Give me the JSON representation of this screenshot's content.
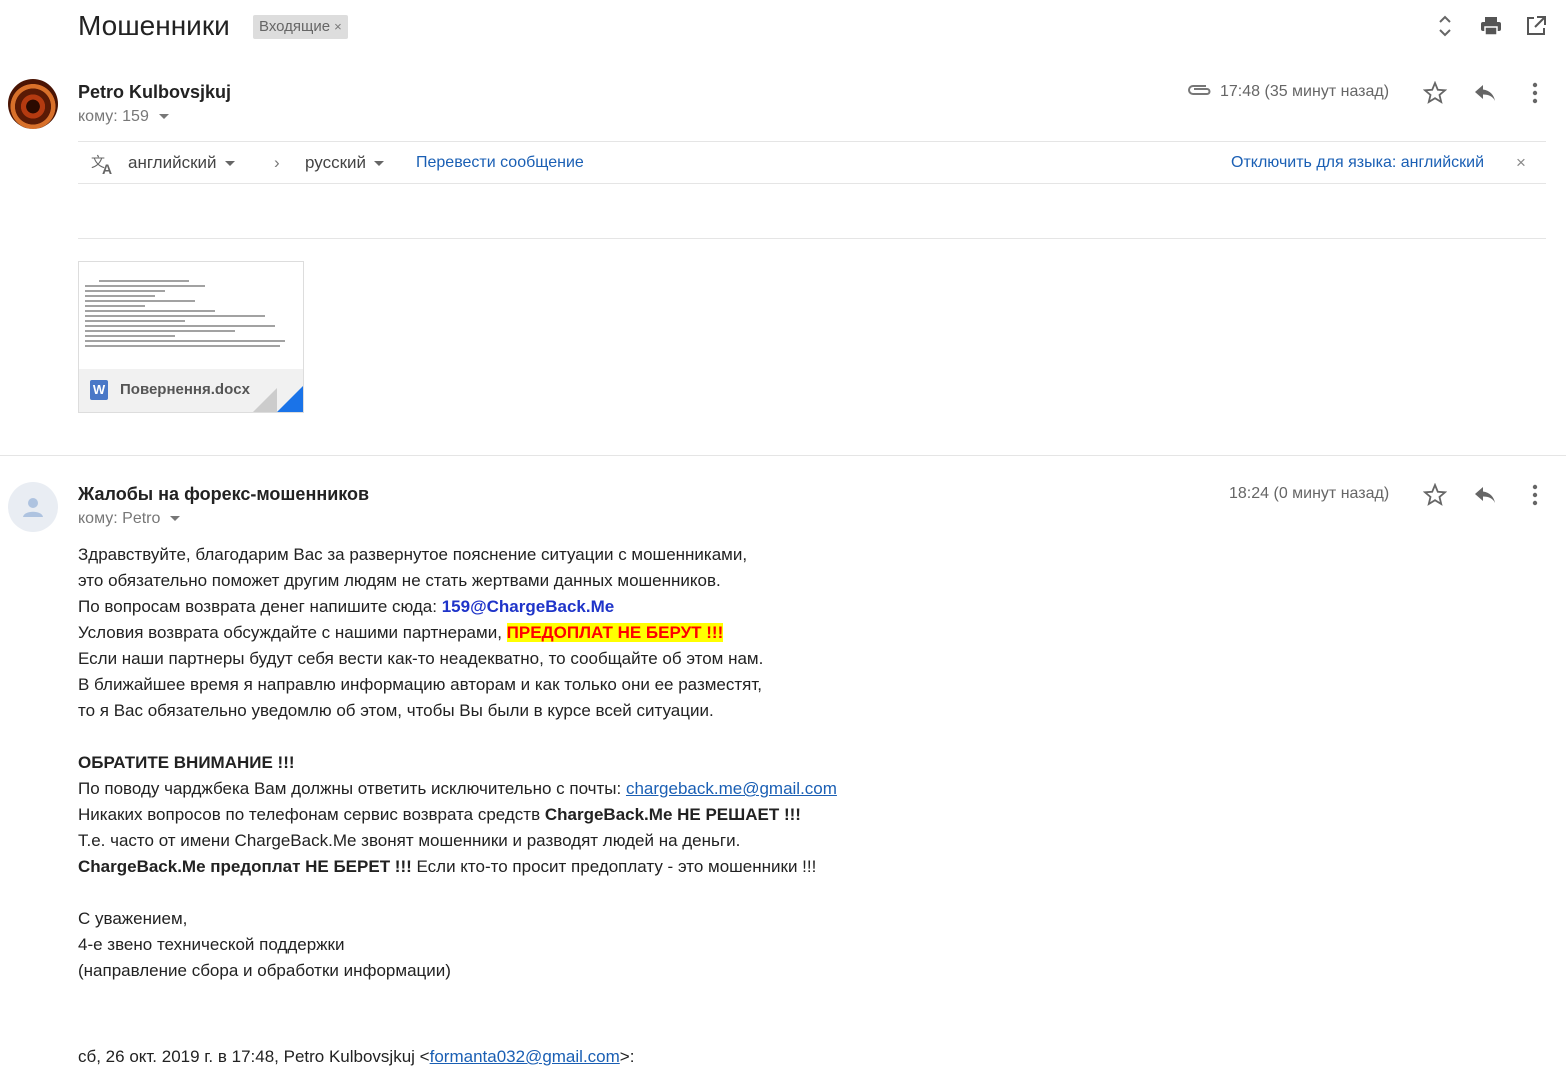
{
  "thread": {
    "subject": "Мошенники",
    "label": "Входящие",
    "label_close": "×"
  },
  "message1": {
    "sender": "Petro Kulbovsjkuj",
    "to": "кому: 159",
    "time": "17:48 (35 минут назад)",
    "attachment_name": "Повернення.docx",
    "attachment_type_letter": "W"
  },
  "translate_bar": {
    "source_lang": "английский",
    "arrow": "›",
    "target_lang": "русский",
    "translate_link": "Перевести сообщение",
    "disable_link": "Отключить для языка: английский",
    "close": "×"
  },
  "message2": {
    "sender": "Жалобы на форекс-мошенников",
    "to": "кому: Petro",
    "time": "18:24 (0 минут назад)",
    "lines": {
      "l1": "Здравствуйте, благодарим Вас за развернутое пояснение ситуации с мошенниками,",
      "l2": "это обязательно поможет другим людям не стать жертвами данных мошенников.",
      "l3a": "По вопросам возврата денег напишите сюда: ",
      "l3b": "159@ChargeBack.Me",
      "l4a": "Условия возврата обсуждайте с нашими партнерами, ",
      "l4b": "ПРЕДОПЛАТ НЕ БЕРУТ !!!",
      "l5": "Если наши партнеры будут себя вести как-то неадекватно, то сообщайте об этом нам.",
      "l6": "В ближайшее время я направлю информацию авторам и как только они ее разместят,",
      "l7": "то я Вас обязательно уведомлю об этом, чтобы Вы были в курсе всей ситуации.",
      "l8": "ОБРАТИТЕ ВНИМАНИЕ !!!",
      "l9a": "По поводу чарджбека Вам должны ответить исключительно с почты: ",
      "l9b": "chargeback.me@gmail.com",
      "l10a": "Никаких вопросов по телефонам сервис возврата средств ",
      "l10b": "ChargeBack.Me НЕ РЕШАЕТ !!!",
      "l11": "Т.е. часто от имени ChargeBack.Me звонят мошенники и разводят людей на деньги.",
      "l12a": "ChargeBack.Me предоплат НЕ БЕРЕТ !!!",
      "l12b": " Если кто-то просит предоплату - это мошенники !!!",
      "l13": "С уважением,",
      "l14": "4-е звено технической поддержки",
      "l15": "(направление сбора и обработки информации)"
    },
    "quote_a": "сб, 26 окт. 2019 г. в 17:48, Petro Kulbovsjkuj <",
    "quote_email": "formanta032@gmail.com",
    "quote_b": ">:"
  },
  "icons": [
    "expand-collapse-icon",
    "print-icon",
    "open-new-window-icon",
    "attachment-clip-icon",
    "star-icon",
    "reply-icon",
    "more-vert-icon",
    "translate-icon",
    "default-avatar-icon"
  ]
}
